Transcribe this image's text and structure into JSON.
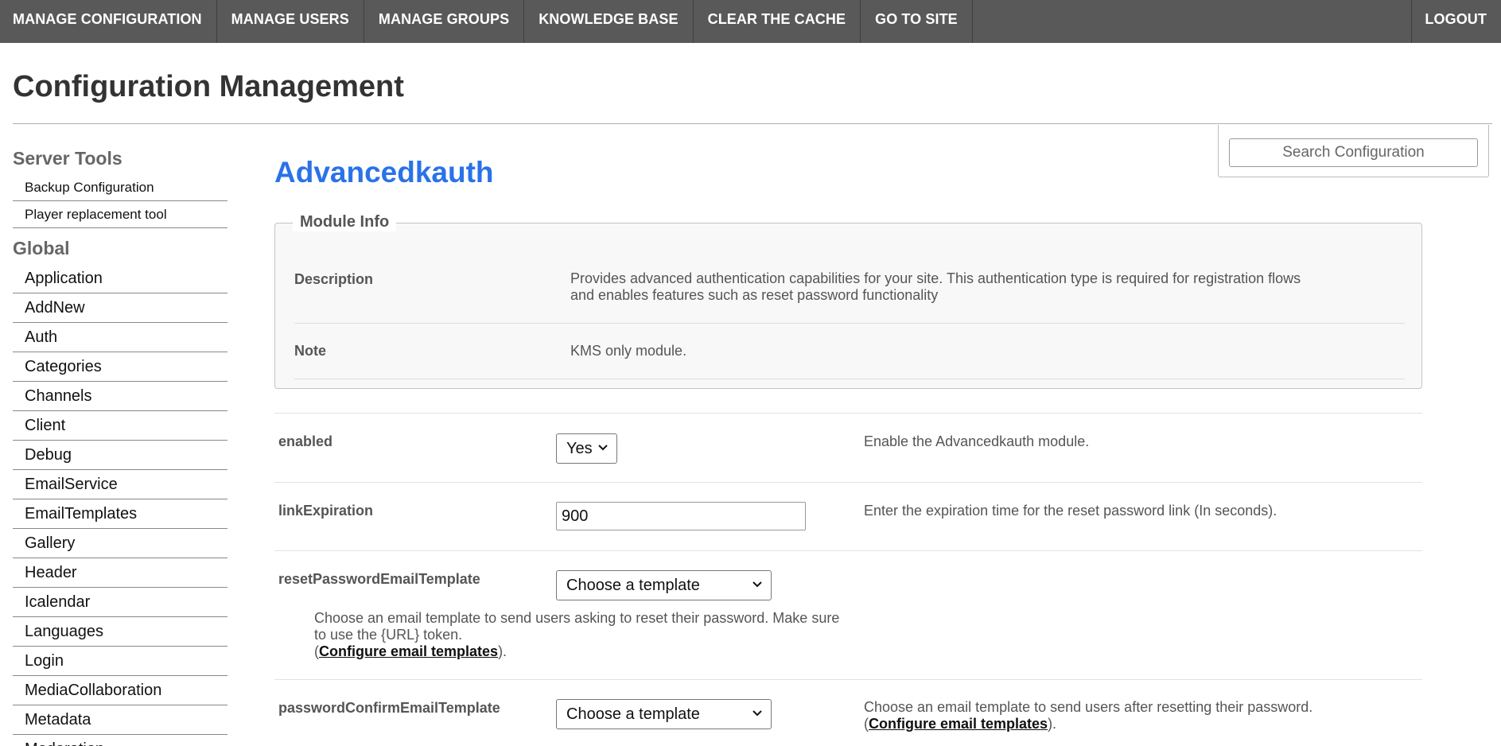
{
  "topnav": {
    "items": [
      "MANAGE CONFIGURATION",
      "MANAGE USERS",
      "MANAGE GROUPS",
      "KNOWLEDGE BASE",
      "CLEAR THE CACHE",
      "GO TO SITE"
    ],
    "logout": "LOGOUT"
  },
  "page": {
    "title": "Configuration Management"
  },
  "search": {
    "placeholder": "Search Configuration"
  },
  "sidebar": {
    "server_tools": {
      "heading": "Server Tools",
      "items": [
        "Backup Configuration",
        "Player replacement tool"
      ]
    },
    "global": {
      "heading": "Global",
      "items": [
        "Application",
        "AddNew",
        "Auth",
        "Categories",
        "Channels",
        "Client",
        "Debug",
        "EmailService",
        "EmailTemplates",
        "Gallery",
        "Header",
        "Icalendar",
        "Languages",
        "Login",
        "MediaCollaboration",
        "Metadata",
        "Moderation"
      ]
    }
  },
  "main": {
    "title": "Advancedkauth",
    "module_info": {
      "legend": "Module Info",
      "description_label": "Description",
      "description_line1": "Provides advanced authentication capabilities for your site. This authentication type is required for registration flows",
      "description_line2": "and enables features such as reset password functionality",
      "note_label": "Note",
      "note_value": "KMS only module."
    },
    "fields": {
      "enabled": {
        "label": "enabled",
        "value": "Yes",
        "desc": "Enable the Advancedkauth module."
      },
      "linkExpiration": {
        "label": "linkExpiration",
        "value": "900",
        "desc": "Enter the expiration time for the reset password link (In seconds)."
      },
      "resetPasswordEmailTemplate": {
        "label": "resetPasswordEmailTemplate",
        "value": "Choose a template",
        "desc_line1": "Choose an email template to send users asking to reset their password. Make sure",
        "desc_line2": "to use the {URL} token.",
        "open_paren": "(",
        "link": "Configure email templates",
        "close_paren": ")."
      },
      "passwordConfirmEmailTemplate": {
        "label": "passwordConfirmEmailTemplate",
        "value": "Choose a template",
        "desc_line1": "Choose an email template to send users after resetting their password.",
        "open_paren": "(",
        "link": "Configure email templates",
        "close_paren": ")."
      }
    }
  }
}
